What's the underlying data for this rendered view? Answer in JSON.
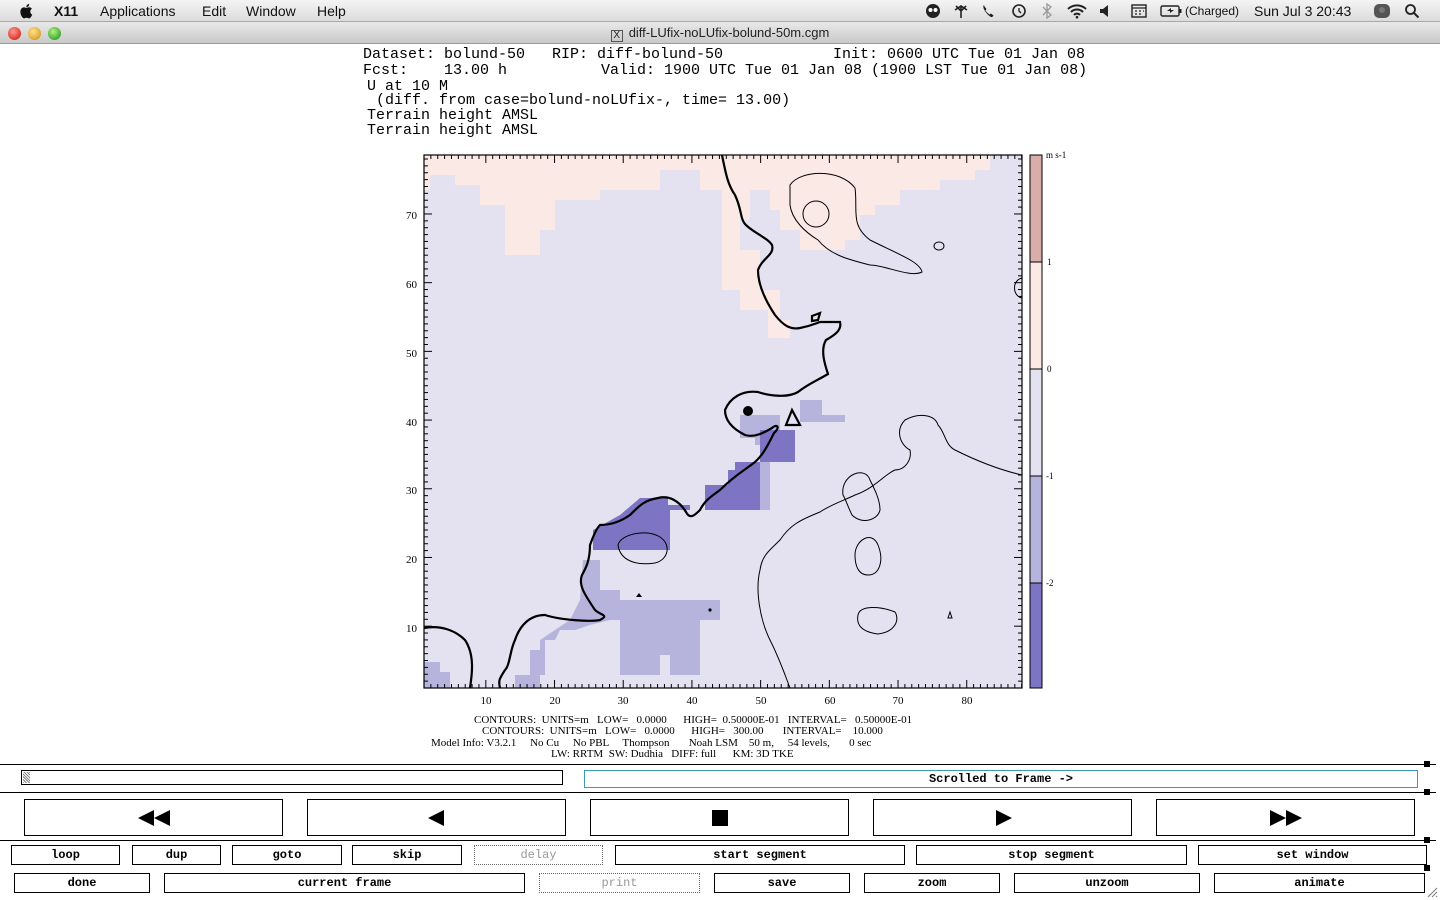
{
  "menubar": {
    "app": "X11",
    "items": [
      "Applications",
      "Edit",
      "Window",
      "Help"
    ],
    "battery": "(Charged)",
    "clock": "Sun Jul 3  20:43"
  },
  "window": {
    "title": "diff-LUfix-noLUfix-bolund-50m.cgm"
  },
  "plot": {
    "header": {
      "line1_left": "Dataset: bolund-50   RIP: diff-bolund-50",
      "line1_right": "Init: 0600 UTC Tue 01 Jan 08",
      "line2_left": "Fcst:    13.00 h",
      "line2_right": "Valid: 1900 UTC Tue 01 Jan 08 (1900 LST Tue 01 Jan 08)",
      "line3": "U at 10 M",
      "line4": " (diff. from case=bolund-noLUfix-, time= 13.00)",
      "line5": "Terrain height AMSL",
      "line6": "Terrain height AMSL"
    },
    "x_ticks": [
      "10",
      "20",
      "30",
      "40",
      "50",
      "60",
      "70",
      "80"
    ],
    "y_ticks": [
      "70",
      "60",
      "50",
      "40",
      "30",
      "20",
      "10"
    ],
    "colorbar": {
      "unit": "m s-1",
      "labels": [
        "1",
        "0",
        "-1",
        "-2"
      ],
      "colors": [
        "#d9aeaa",
        "#fbe9e6",
        "#e4e2f0",
        "#b6b3dc",
        "#7d74c4"
      ]
    },
    "footer": {
      "line1": "CONTOURS:  UNITS=m   LOW=   0.0000      HIGH=  0.50000E-01   INTERVAL=   0.50000E-01",
      "line2": "CONTOURS:  UNITS=m   LOW=   0.0000      HIGH=   300.00       INTERVAL=    10.000",
      "line3": "Model Info: V3.2.1     No Cu     No PBL     Thompson       Noah LSM    50 m,     54 levels,       0 sec",
      "line4": "LW: RRTM  SW: Dudhia   DIFF: full      KM: 3D TKE"
    }
  },
  "controls": {
    "scrolled_label": "Scrolled to Frame ->",
    "row1": [
      "loop",
      "dup",
      "goto",
      "skip",
      "delay",
      "start segment",
      "stop segment",
      "set window"
    ],
    "row2": [
      "done",
      "current frame",
      "print",
      "save",
      "zoom",
      "unzoom",
      "animate"
    ]
  }
}
